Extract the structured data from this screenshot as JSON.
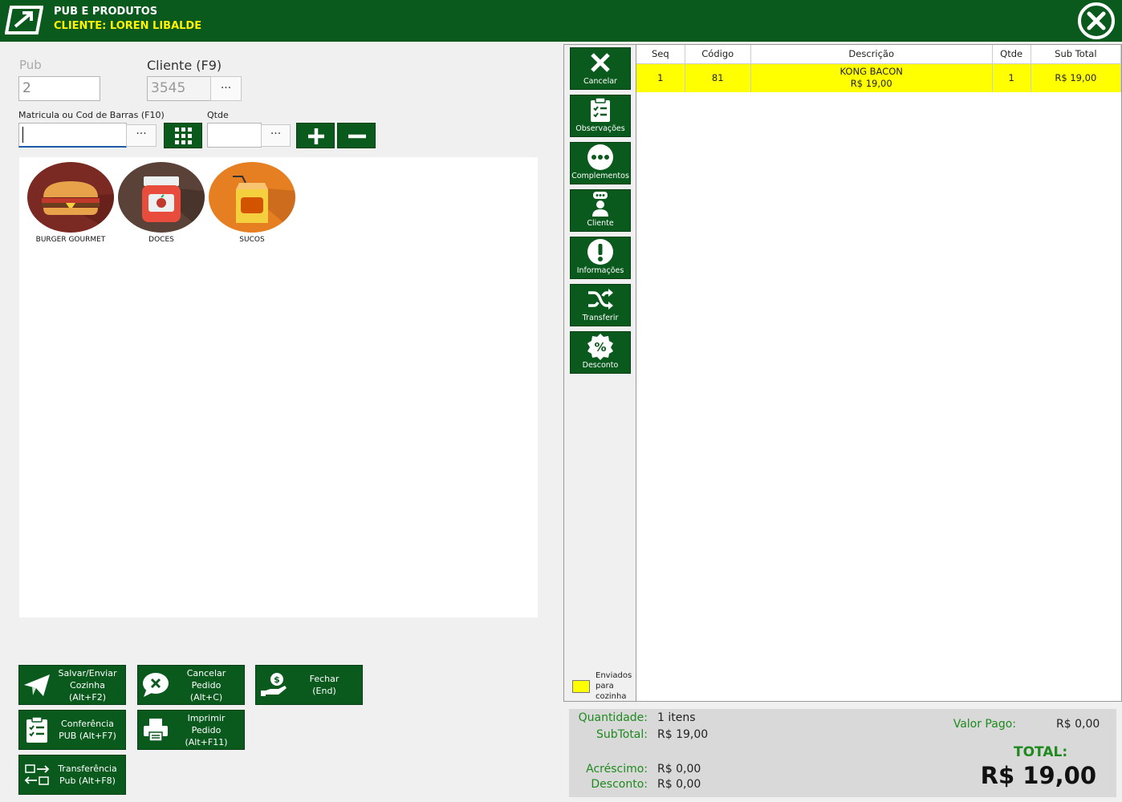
{
  "header": {
    "title": "PUB E PRODUTOS",
    "client": "CLIENTE: LOREN LIBALDE"
  },
  "form": {
    "pub_label": "Pub",
    "pub_value": "2",
    "client_label": "Cliente (F9)",
    "client_value": "3545",
    "matricula_label": "Matricula ou Cod de Barras (F10)",
    "matricula_value": "",
    "qtde_label": "Qtde",
    "qtde_value": "",
    "dots": "···"
  },
  "categories": [
    {
      "label": "BURGER GOURMET"
    },
    {
      "label": "DOCES"
    },
    {
      "label": "SUCOS"
    }
  ],
  "actions": {
    "salvar": [
      "Salvar/Enviar",
      "Cozinha (Alt+F2)"
    ],
    "cancelar_pedido": [
      "Cancelar Pedido",
      "(Alt+C)"
    ],
    "fechar": [
      "Fechar",
      "(End)"
    ],
    "conferencia": [
      "Conferência",
      "PUB (Alt+F7)"
    ],
    "imprimir": [
      "Imprimir Pedido",
      "(Alt+F11)"
    ],
    "transferencia": [
      "Transferência",
      "Pub (Alt+F8)"
    ]
  },
  "side_buttons": [
    {
      "label": "Cancelar",
      "icon": "x-icon"
    },
    {
      "label": "Observações",
      "icon": "clipboard-check-icon"
    },
    {
      "label": "Complementos",
      "icon": "ellipsis-circle-icon"
    },
    {
      "label": "Cliente",
      "icon": "user-chat-icon"
    },
    {
      "label": "Informações",
      "icon": "exclamation-circle-icon"
    },
    {
      "label": "Transferir",
      "icon": "shuffle-icon"
    },
    {
      "label": "Desconto",
      "icon": "percent-badge-icon"
    }
  ],
  "grid": {
    "columns": [
      "Seq",
      "Código",
      "Descrição",
      "Qtde",
      "Sub Total"
    ],
    "rows": [
      {
        "seq": "1",
        "codigo": "81",
        "descricao": "KONG BACON",
        "preco": "R$ 19,00",
        "qtde": "1",
        "subtotal": "R$ 19,00"
      }
    ]
  },
  "legend": {
    "color": "#ffff00",
    "line1": "Enviados",
    "line2": "para",
    "line3": "cozinha"
  },
  "totals": {
    "quantidade_label": "Quantidade:",
    "quantidade_value": "1 itens",
    "subtotal_label": "SubTotal:",
    "subtotal_value": "R$ 19,00",
    "acrescimo_label": "Acréscimo:",
    "acrescimo_value": "R$ 0,00",
    "desconto_label": "Desconto:",
    "desconto_value": "R$ 0,00",
    "valor_pago_label": "Valor Pago:",
    "valor_pago_value": "R$ 0,00",
    "total_label": "TOTAL:",
    "total_value": "R$ 19,00"
  },
  "colors": {
    "brand": "#0a5a1e",
    "client_highlight": "#fff200",
    "row_highlight": "#ffff00",
    "label_green": "#1e8a1e"
  }
}
